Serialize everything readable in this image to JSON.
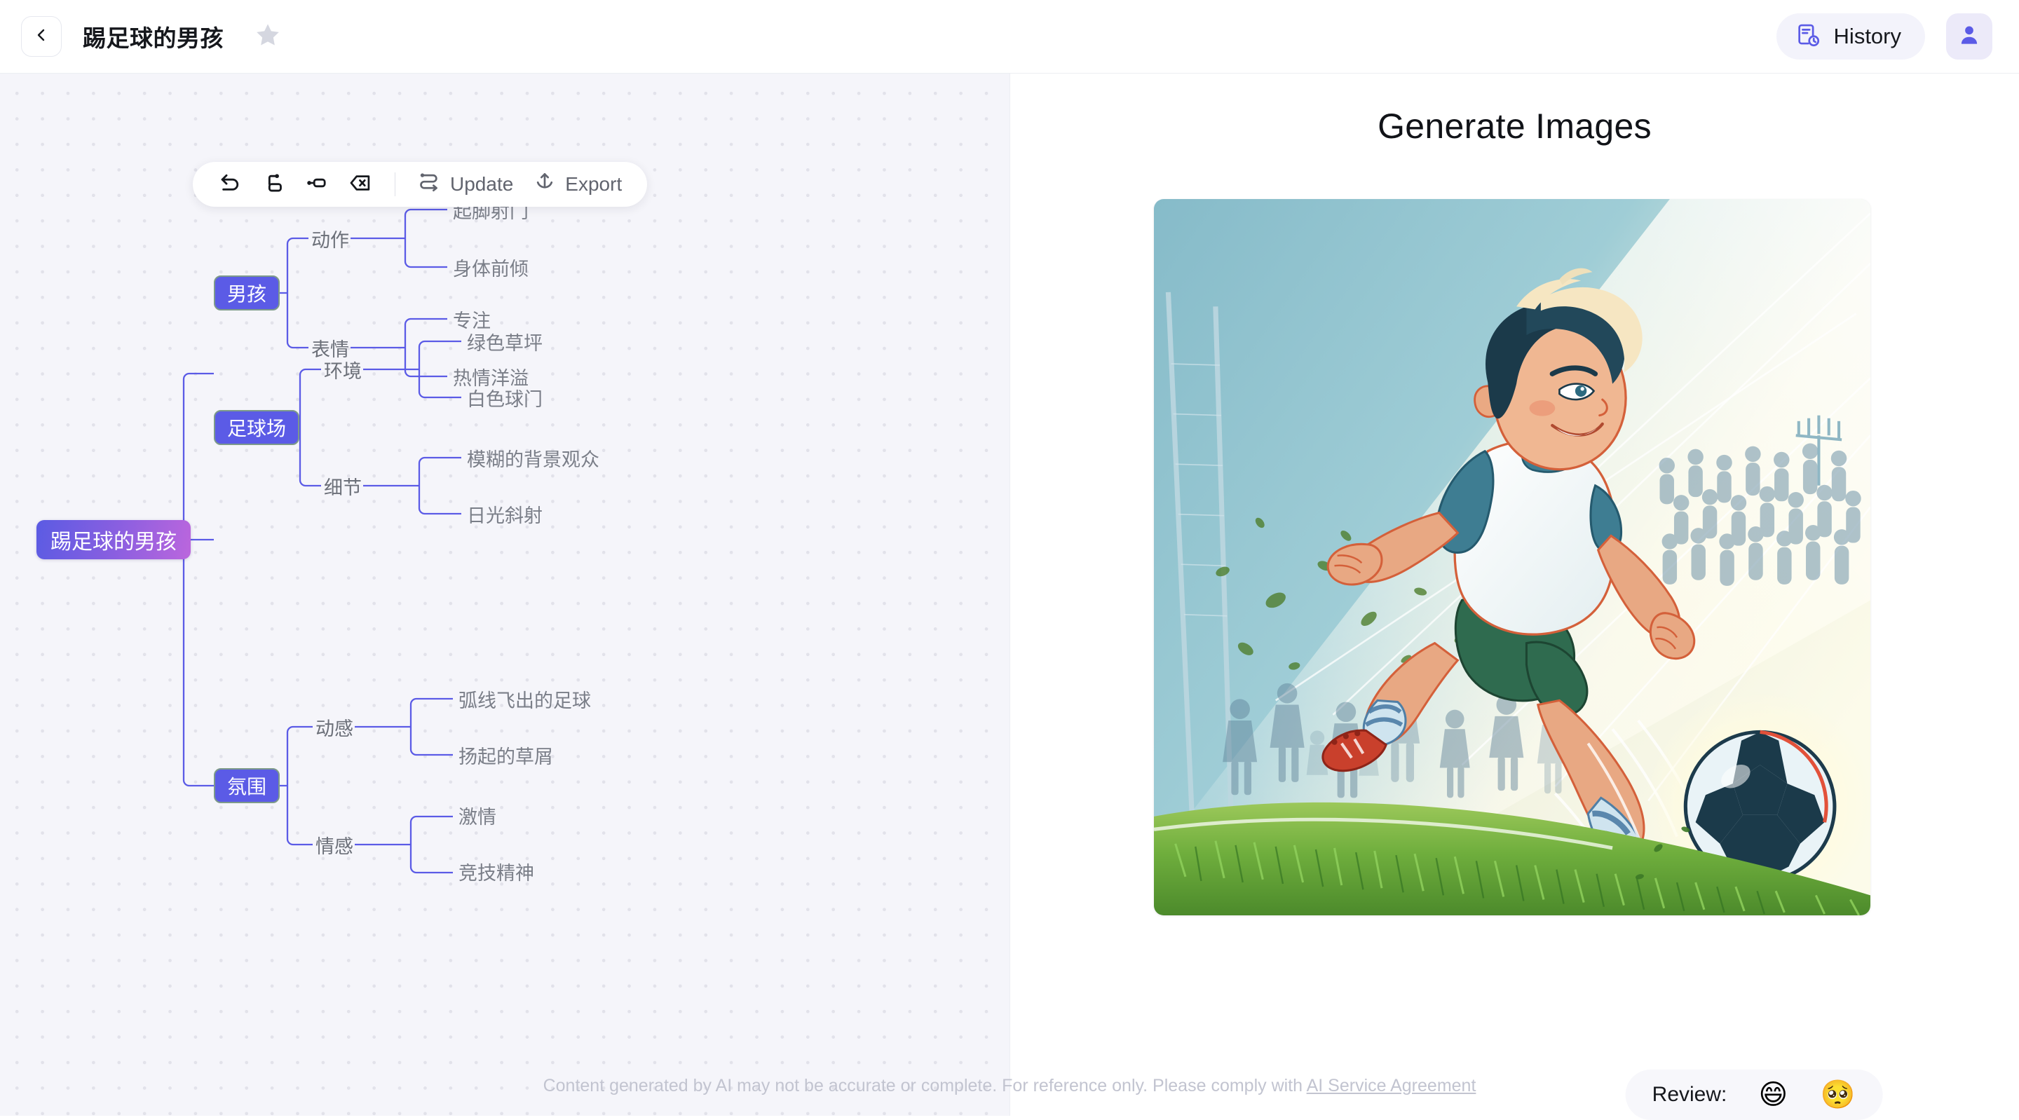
{
  "header": {
    "back_icon": "chevron-left-icon",
    "title": "踢足球的男孩",
    "star_icon": "star-icon",
    "history_label": "History",
    "history_icon": "document-clock-icon",
    "avatar_icon": "user-avatar-icon"
  },
  "toolbar": {
    "undo_icon": "undo-icon",
    "add_sibling_icon": "add-sibling-node-icon",
    "add_child_icon": "add-child-node-icon",
    "delete_icon": "delete-node-icon",
    "update_label": "Update",
    "update_icon": "update-flow-icon",
    "export_label": "Export",
    "export_icon": "export-upload-icon"
  },
  "mindmap": {
    "root": "踢足球的男孩",
    "branches": [
      {
        "label": "男孩",
        "groups": [
          {
            "label": "动作",
            "leaves": [
              "起脚射门",
              "身体前倾"
            ]
          },
          {
            "label": "表情",
            "leaves": [
              "专注",
              "热情洋溢"
            ]
          }
        ]
      },
      {
        "label": "足球场",
        "groups": [
          {
            "label": "环境",
            "leaves": [
              "绿色草坪",
              "白色球门"
            ]
          },
          {
            "label": "细节",
            "leaves": [
              "模糊的背景观众",
              "日光斜射"
            ]
          }
        ]
      },
      {
        "label": "氛围",
        "groups": [
          {
            "label": "动感",
            "leaves": [
              "弧线飞出的足球",
              "扬起的草屑"
            ]
          },
          {
            "label": "情感",
            "leaves": [
              "激情",
              "竞技精神"
            ]
          }
        ]
      }
    ]
  },
  "right": {
    "title": "Generate Images",
    "image_alt": "卡通插画：一个男孩在绿色草坪上起脚射门，足球飞出",
    "review_label": "Review:",
    "review_positive_emoji": "😄",
    "review_negative_emoji": "🥺"
  },
  "footer": {
    "text": "Content generated by AI may not be accurate or complete. For reference only. Please comply with ",
    "link": "AI Service Agreement"
  },
  "colors": {
    "accent": "#5b5be6",
    "root_gradient_start": "#5b5be3",
    "root_gradient_end": "#bb66dd",
    "canvas_bg": "#f5f5fa",
    "link_line": "#5b5be6",
    "leaf_text": "#6b6f78"
  }
}
